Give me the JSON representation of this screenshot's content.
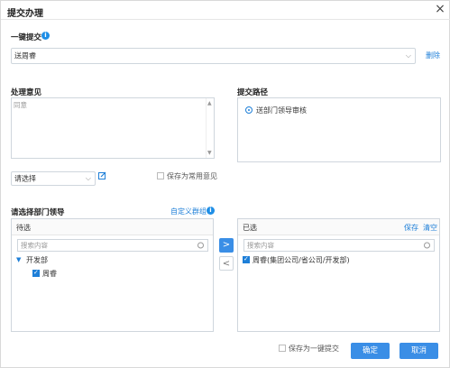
{
  "dialog": {
    "title": "提交办理",
    "close_symbol": "×"
  },
  "quick_submit": {
    "label": "一键提交",
    "info_symbol": "i",
    "selected_value": "送周睿",
    "delete_label": "删除"
  },
  "opinion": {
    "label": "处理意见",
    "text": "同意",
    "select_placeholder": "请选择",
    "save_common_label": "保存为常用意见",
    "save_common_checked": false
  },
  "path": {
    "label": "提交路径",
    "options": [
      {
        "label": "送部门领导审核",
        "selected": true
      }
    ]
  },
  "leaders": {
    "label": "请选择部门领导",
    "custom_group_label": "自定义群组",
    "pending": {
      "title": "待选",
      "search_placeholder": "搜索内容",
      "tree": [
        {
          "label": "开发部",
          "expanded": true,
          "children": [
            {
              "label": "周睿",
              "checked": true
            }
          ]
        }
      ]
    },
    "move_right_symbol": ">",
    "move_left_symbol": "<",
    "selected": {
      "title": "已选",
      "save_label": "保存",
      "clear_label": "清空",
      "search_placeholder": "搜索内容",
      "items": [
        {
          "label": "周睿(集团公司/省公司/开发部)",
          "checked": true
        }
      ]
    }
  },
  "footer": {
    "save_quick_label": "保存为一键提交",
    "save_quick_checked": false,
    "confirm_label": "确定",
    "cancel_label": "取消"
  },
  "colors": {
    "accent": "#3a8ee6",
    "link": "#1e7fd8"
  }
}
